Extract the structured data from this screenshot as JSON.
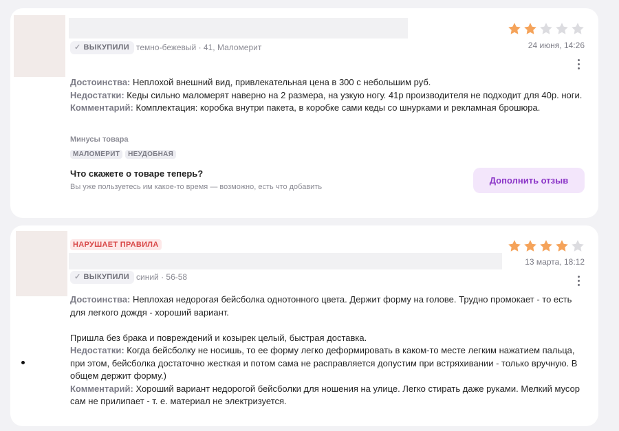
{
  "reviews": [
    {
      "badge": "ВЫКУПИЛИ",
      "variant": "темно-бежевый · 41, Маломерит",
      "rating": 2,
      "date": "24 июня, 14:26",
      "pros_label": "Достоинства:",
      "pros": "Неплохой внешний вид, привлекательная цена в 300 с небольшим руб.",
      "cons_label": "Недостатки:",
      "cons": "Кеды сильно маломерят наверно на 2 размера, на узкую ногу. 41р производителя не подходит для 40р. ноги.",
      "comment_label": "Комментарий:",
      "comment": "Комплектация: коробка внутри пакета, в коробке сами кеды со шнурками и рекламная брошюра.",
      "minus_title": "Минусы товара",
      "tags": [
        "МАЛОМЕРИТ",
        "НЕУДОБНАЯ"
      ],
      "prompt_title": "Что скажете о товаре теперь?",
      "prompt_sub": "Вы уже пользуетесь им какое-то время — возможно, есть что добавить",
      "add_button": "Дополнить отзыв"
    },
    {
      "violation": "НАРУШАЕТ ПРАВИЛА",
      "badge": "ВЫКУПИЛИ",
      "variant": "синий · 56-58",
      "rating": 4,
      "date": "13 марта, 18:12",
      "pros_label": "Достоинства:",
      "pros": "Неплохая недорогая бейсболка однотонного цвета. Держит форму на голове. Трудно промокает - то есть для легкого дождя - хороший вариант.",
      "pros_extra": "Пришла без брака и повреждений и козырек целый, быстрая доставка.",
      "cons_label": "Недостатки:",
      "cons": "Когда бейсболку не носишь, то ее форму легко деформировать в каком-то месте легким нажатием пальца, при этом, бейсболка достаточно жесткая и потом сама не расправляется допустим при встряхивании - только вручную. В общем держит форму.)",
      "comment_label": "Комментарий:",
      "comment": "Хороший вариант недорогой бейсболки для ношения на улице. Легко стирать даже руками. Мелкий мусор сам не прилипает - т. е. материал не электризуется."
    }
  ],
  "colors": {
    "star_on": "#f5a35a",
    "star_off": "#dcdce0",
    "accent": "#8b35c7",
    "violation": "#d84848"
  }
}
